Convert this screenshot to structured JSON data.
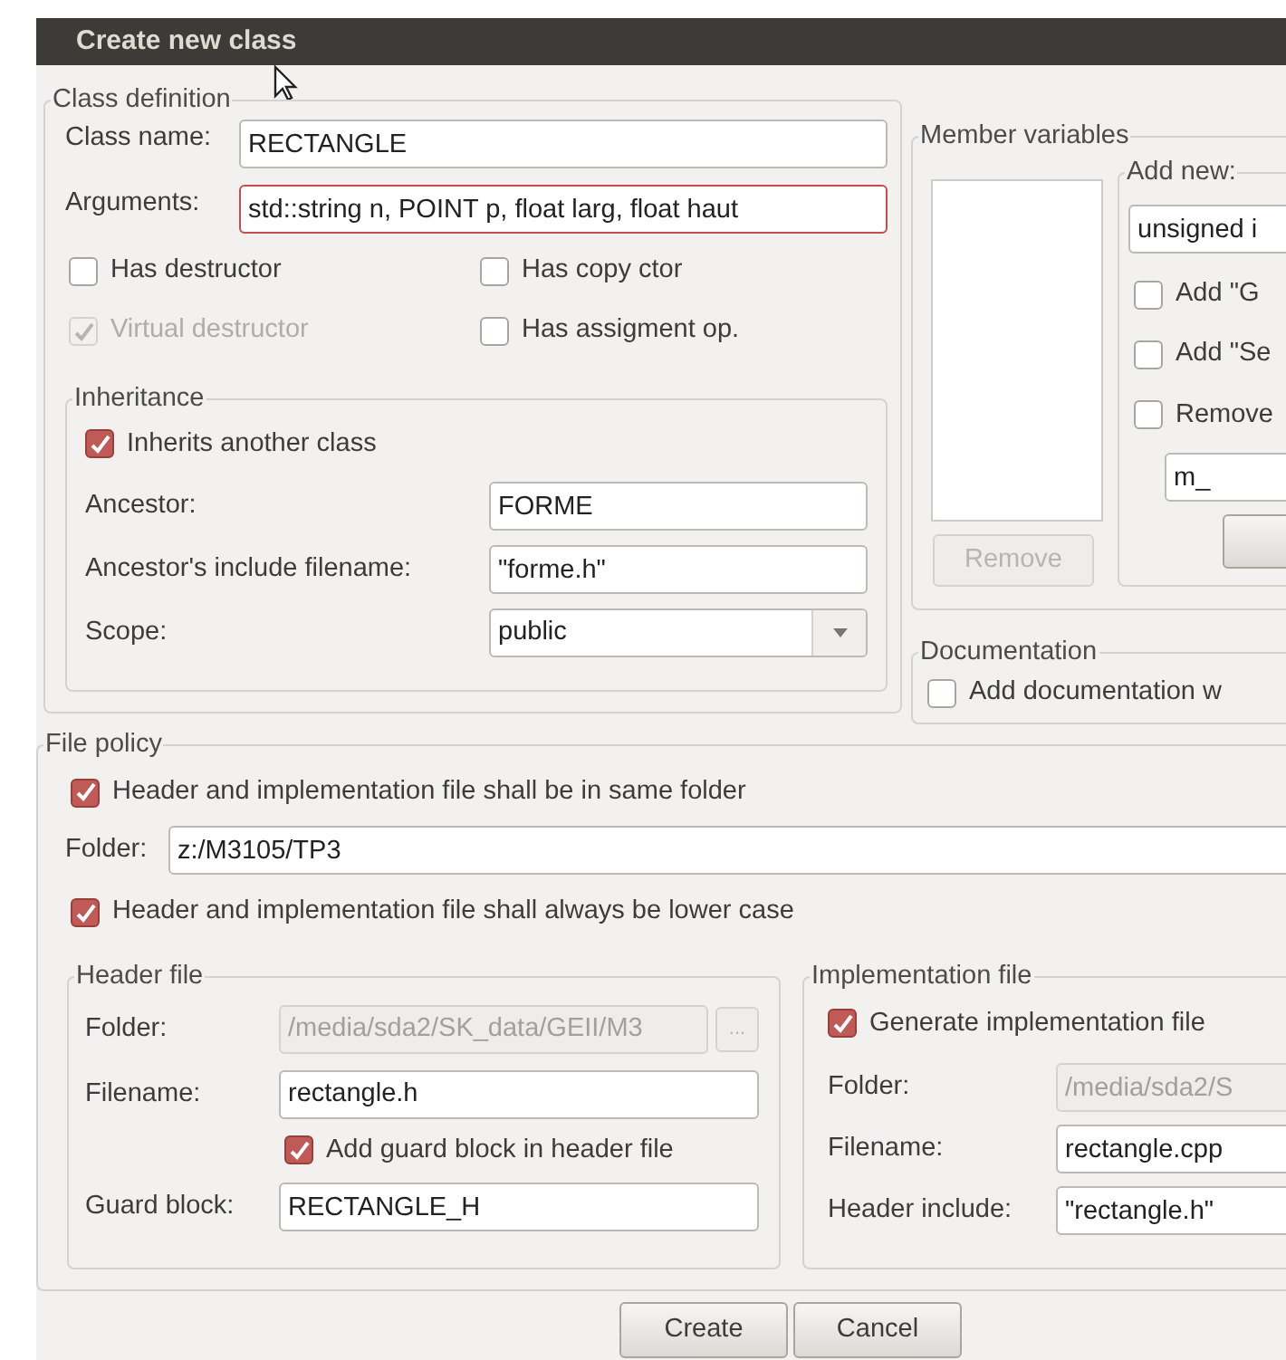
{
  "window": {
    "title": "Create new class"
  },
  "class_definition": {
    "title": "Class definition",
    "fields": [
      {
        "label": "Class name:",
        "value": "RECTANGLE",
        "focused": false
      },
      {
        "label": "Arguments:",
        "value": "std::string n, POINT p, float larg, float haut",
        "focused": true
      }
    ],
    "options": [
      {
        "label": "Has destructor",
        "checked": false,
        "disabled": false
      },
      {
        "label": "Has copy ctor",
        "checked": false,
        "disabled": false
      },
      {
        "label": "Virtual destructor",
        "checked": true,
        "disabled": true
      },
      {
        "label": "Has assigment op.",
        "checked": false,
        "disabled": false
      }
    ],
    "inheritance": {
      "title": "Inheritance",
      "inherits": {
        "label": "Inherits another class",
        "checked": true
      },
      "fields": [
        {
          "label": "Ancestor:",
          "value": "FORME",
          "kind": "text"
        },
        {
          "label": "Ancestor's include filename:",
          "value": "\"forme.h\"",
          "kind": "text"
        },
        {
          "label": "Scope:",
          "value": "public",
          "kind": "dropdown"
        }
      ]
    }
  },
  "member_variables": {
    "title": "Member variables",
    "remove_button": {
      "label": "Remove",
      "disabled": true
    },
    "add_new": {
      "title": "Add new:",
      "type_value": "unsigned i",
      "options": [
        {
          "label": "Add \"G",
          "checked": false
        },
        {
          "label": "Add \"Se",
          "checked": false
        },
        {
          "label": "Remove",
          "checked": false
        }
      ],
      "prefix_value": "m_"
    }
  },
  "documentation": {
    "title": "Documentation",
    "option": {
      "label": "Add documentation w",
      "checked": false
    }
  },
  "file_policy": {
    "title": "File policy",
    "same_folder": {
      "label": "Header and implementation file shall be in same folder",
      "checked": true
    },
    "folder": {
      "label": "Folder:",
      "value": "z:/M3105/TP3"
    },
    "lower_case": {
      "label": "Header and implementation file shall always be lower case",
      "checked": true
    },
    "header_file": {
      "title": "Header file",
      "folder": {
        "label": "Folder:",
        "value": "/media/sda2/SK_data/GEII/M3",
        "disabled": true
      },
      "browse_button": {
        "label": "...",
        "disabled": true
      },
      "filename": {
        "label": "Filename:",
        "value": "rectangle.h"
      },
      "guard_option": {
        "label": "Add guard block in header file",
        "checked": true
      },
      "guard_block": {
        "label": "Guard block:",
        "value": "RECTANGLE_H"
      }
    },
    "implementation_file": {
      "title": "Implementation file",
      "generate": {
        "label": "Generate implementation file",
        "checked": true
      },
      "folder": {
        "label": "Folder:",
        "value": "/media/sda2/S",
        "disabled": true
      },
      "filename": {
        "label": "Filename:",
        "value": "rectangle.cpp"
      },
      "header_include": {
        "label": "Header include:",
        "value": "\"rectangle.h\""
      }
    }
  },
  "buttons": [
    {
      "label": "Create"
    },
    {
      "label": "Cancel"
    }
  ]
}
